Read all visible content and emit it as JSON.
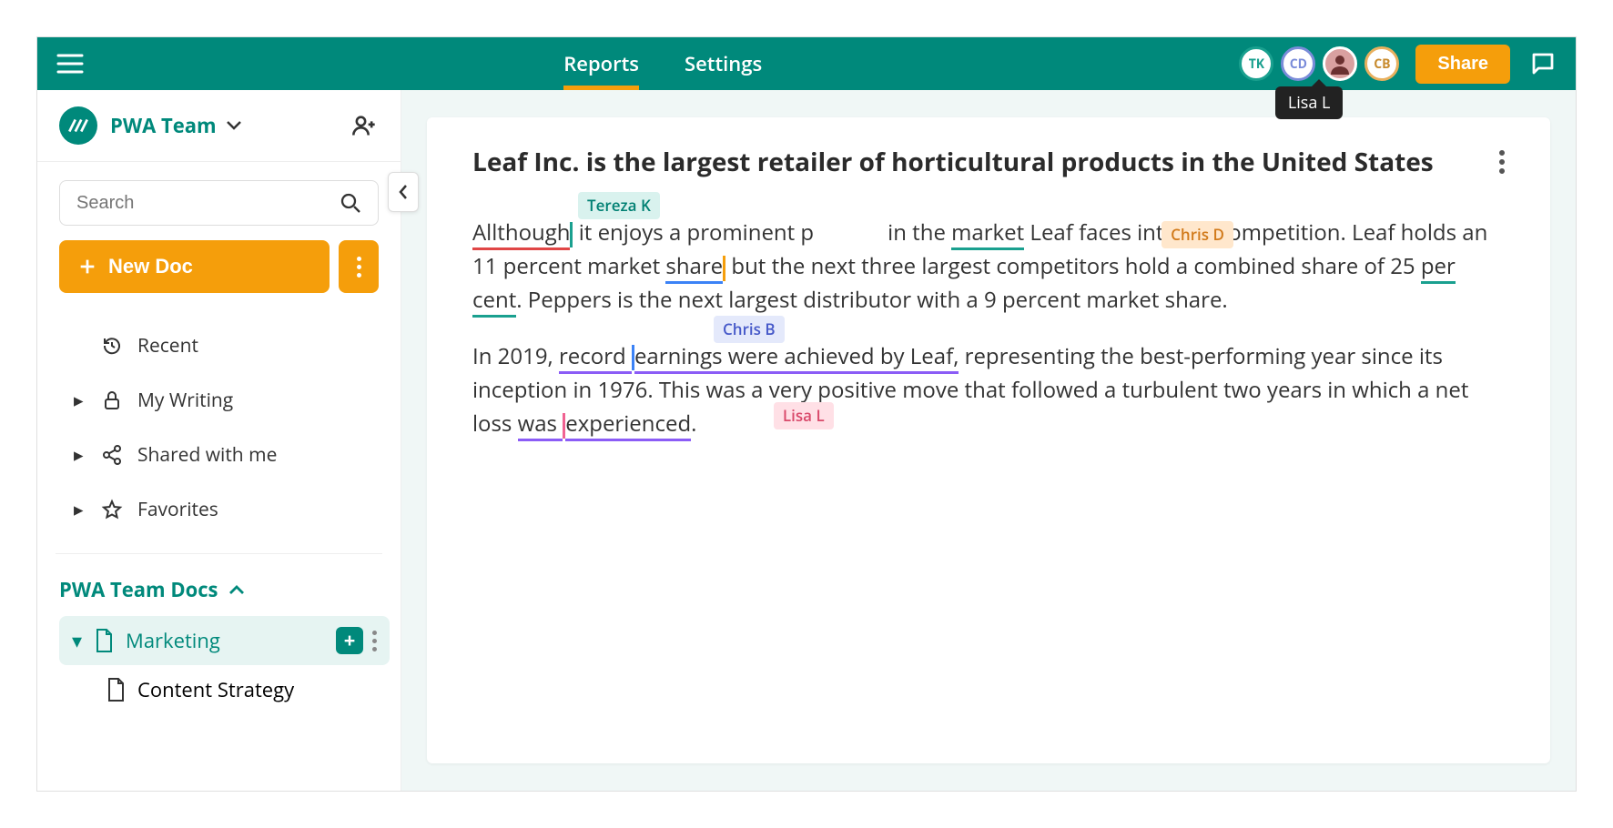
{
  "topbar": {
    "nav": {
      "reports": "Reports",
      "settings": "Settings",
      "active": "reports"
    },
    "avatars": {
      "tk": "TK",
      "cd": "CD",
      "cb": "CB",
      "photo": "👤"
    },
    "tooltip": "Lisa L",
    "share_label": "Share"
  },
  "sidebar": {
    "workspace_name": "PWA Team",
    "search_placeholder": "Search",
    "new_doc_label": "New Doc",
    "nav": {
      "recent": "Recent",
      "my_writing": "My Writing",
      "shared": "Shared with me",
      "favorites": "Favorites"
    },
    "section_label": "PWA Team Docs",
    "tree": {
      "marketing": "Marketing",
      "content_strategy": "Content Strategy"
    }
  },
  "document": {
    "title": "Leaf Inc. is the largest retailer of horticultural products in the United States",
    "p1_allthough": "Allthough",
    "p1_seg1": " it enjoys a prominent p",
    "p1_seg2": " in the ",
    "p1_market": "market",
    "p1_seg3": " Leaf faces intense competition. Leaf holds an 11 percent market ",
    "p1_share": "share",
    "p1_seg4": " but the next three largest competitors hold a combined share of 25 ",
    "p1_percent": "per cent",
    "p1_seg5": ". Peppers is the next largest distributor with a 9 percent market share.",
    "p2_seg1": "In 2019, ",
    "p2_recearn": "record earnings were achieved by Leaf,",
    "p2_seg2": " representing the best-performing year since its inception in 1976. This was a very positive move that followed a turbulent two years in which a net loss ",
    "p2_wasexp": "was experienced",
    "p2_seg3": ".",
    "cursor_tags": {
      "tereza": "Tereza K",
      "chrisd": "Chris D",
      "chrisb": "Chris B",
      "lisal": "Lisa L"
    }
  }
}
